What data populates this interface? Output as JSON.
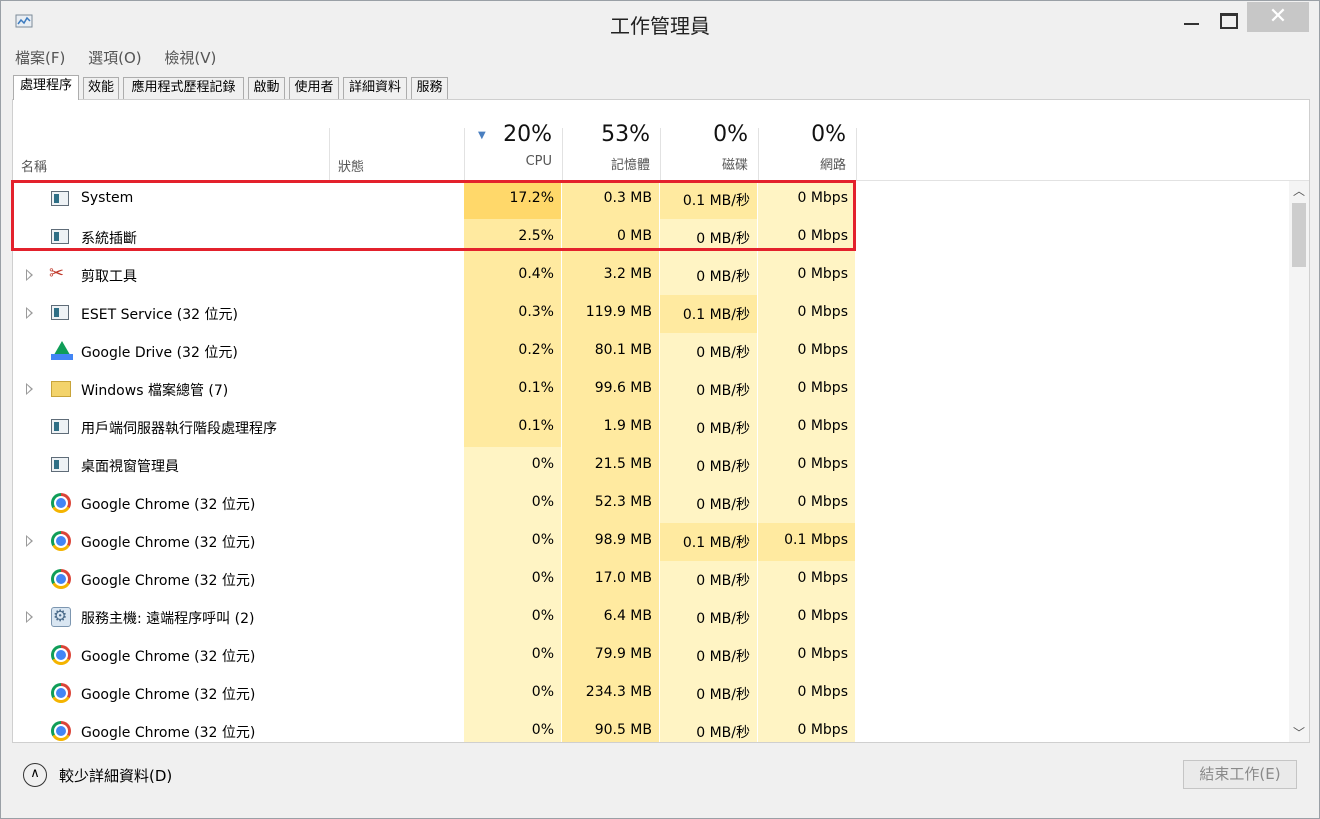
{
  "window": {
    "title": "工作管理員"
  },
  "menu": [
    "檔案(F)",
    "選項(O)",
    "檢視(V)"
  ],
  "tabs": [
    "處理程序",
    "效能",
    "應用程式歷程記錄",
    "啟動",
    "使用者",
    "詳細資料",
    "服務"
  ],
  "columns": {
    "name": "名稱",
    "status": "狀態",
    "cpu": {
      "pct": "20%",
      "label": "CPU"
    },
    "memory": {
      "pct": "53%",
      "label": "記憶體"
    },
    "disk": {
      "pct": "0%",
      "label": "磁碟"
    },
    "network": {
      "pct": "0%",
      "label": "網路"
    }
  },
  "rows": [
    {
      "name": "System",
      "icon": "app-window-icon",
      "expand": false,
      "cpu": "17.2%",
      "memory": "0.3 MB",
      "disk": "0.1 MB/秒",
      "network": "0 Mbps"
    },
    {
      "name": "系統插斷",
      "icon": "app-window-icon",
      "expand": false,
      "cpu": "2.5%",
      "memory": "0 MB",
      "disk": "0 MB/秒",
      "network": "0 Mbps"
    },
    {
      "name": "剪取工具",
      "icon": "scissors-icon",
      "expand": true,
      "cpu": "0.4%",
      "memory": "3.2 MB",
      "disk": "0 MB/秒",
      "network": "0 Mbps"
    },
    {
      "name": "ESET Service (32 位元)",
      "icon": "app-window-icon",
      "expand": true,
      "cpu": "0.3%",
      "memory": "119.9 MB",
      "disk": "0.1 MB/秒",
      "network": "0 Mbps"
    },
    {
      "name": "Google Drive (32 位元)",
      "icon": "google-drive-icon",
      "expand": false,
      "cpu": "0.2%",
      "memory": "80.1 MB",
      "disk": "0 MB/秒",
      "network": "0 Mbps"
    },
    {
      "name": "Windows 檔案總管 (7)",
      "icon": "folder-icon",
      "expand": true,
      "cpu": "0.1%",
      "memory": "99.6 MB",
      "disk": "0 MB/秒",
      "network": "0 Mbps"
    },
    {
      "name": "用戶端伺服器執行階段處理程序",
      "icon": "app-window-icon",
      "expand": false,
      "cpu": "0.1%",
      "memory": "1.9 MB",
      "disk": "0 MB/秒",
      "network": "0 Mbps"
    },
    {
      "name": "桌面視窗管理員",
      "icon": "app-window-icon",
      "expand": false,
      "cpu": "0%",
      "memory": "21.5 MB",
      "disk": "0 MB/秒",
      "network": "0 Mbps"
    },
    {
      "name": "Google Chrome (32 位元)",
      "icon": "chrome-icon",
      "expand": false,
      "cpu": "0%",
      "memory": "52.3 MB",
      "disk": "0 MB/秒",
      "network": "0 Mbps"
    },
    {
      "name": "Google Chrome (32 位元)",
      "icon": "chrome-icon",
      "expand": true,
      "cpu": "0%",
      "memory": "98.9 MB",
      "disk": "0.1 MB/秒",
      "network": "0.1 Mbps"
    },
    {
      "name": "Google Chrome (32 位元)",
      "icon": "chrome-icon",
      "expand": false,
      "cpu": "0%",
      "memory": "17.0 MB",
      "disk": "0 MB/秒",
      "network": "0 Mbps"
    },
    {
      "name": "服務主機: 遠端程序呼叫 (2)",
      "icon": "gear-icon",
      "expand": true,
      "cpu": "0%",
      "memory": "6.4 MB",
      "disk": "0 MB/秒",
      "network": "0 Mbps"
    },
    {
      "name": "Google Chrome (32 位元)",
      "icon": "chrome-icon",
      "expand": false,
      "cpu": "0%",
      "memory": "79.9 MB",
      "disk": "0 MB/秒",
      "network": "0 Mbps"
    },
    {
      "name": "Google Chrome (32 位元)",
      "icon": "chrome-icon",
      "expand": false,
      "cpu": "0%",
      "memory": "234.3 MB",
      "disk": "0 MB/秒",
      "network": "0 Mbps"
    },
    {
      "name": "Google Chrome (32 位元)",
      "icon": "chrome-icon",
      "expand": false,
      "cpu": "0%",
      "memory": "90.5 MB",
      "disk": "0 MB/秒",
      "network": "0 Mbps"
    }
  ],
  "footer": {
    "fewer_details": "較少詳細資料(D)",
    "end_task": "結束工作(E)"
  },
  "colors": {
    "heat_light": "#fff4c4",
    "heat_mid": "#ffeaa0",
    "heat_high": "#ffd86a",
    "highlight_frame": "#e3212c"
  }
}
